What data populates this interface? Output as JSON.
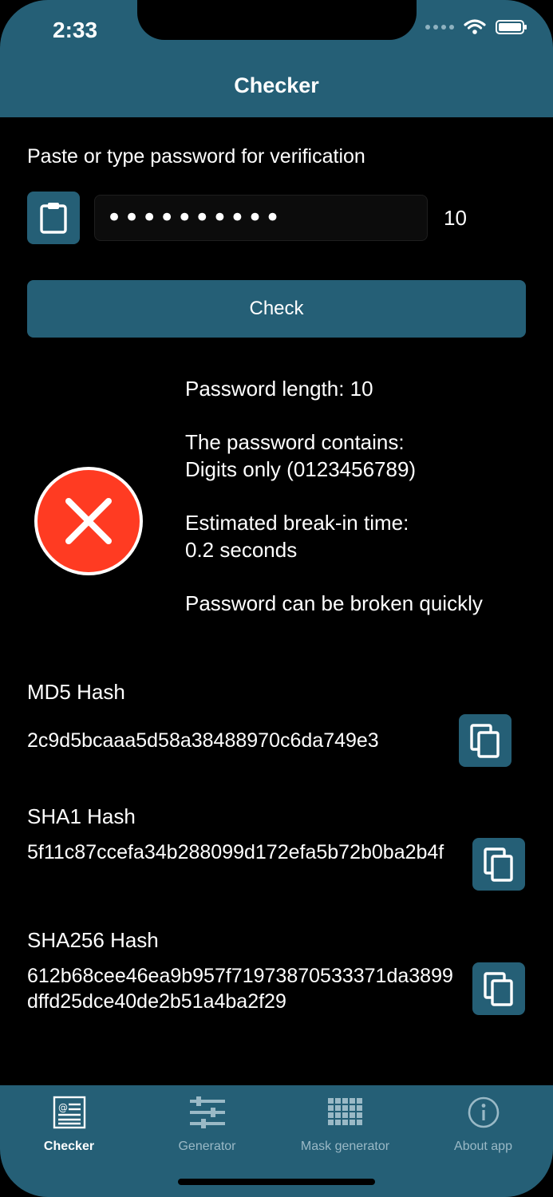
{
  "status": {
    "time": "2:33"
  },
  "nav": {
    "title": "Checker"
  },
  "checker": {
    "prompt": "Paste or type password for verification",
    "password_value": "••••••••••",
    "password_count": "10",
    "check_label": "Check"
  },
  "result": {
    "length": "Password length: 10",
    "contains_title": "The password contains:",
    "contains_value": "Digits only (0123456789)",
    "time_title": "Estimated break-in time:",
    "time_value": "0.2 seconds",
    "verdict": "Password can be broken quickly",
    "status_color": "#ff3b22"
  },
  "hashes": {
    "md5": {
      "label": "MD5 Hash",
      "value": "2c9d5bcaaa5d58a38488970c6da749e3"
    },
    "sha1": {
      "label": "SHA1 Hash",
      "value": "5f11c87ccefa34b288099d172efa5b72b0ba2b4f"
    },
    "sha256": {
      "label": "SHA256 Hash",
      "value": "612b68cee46ea9b957f71973870533371da3899dffd25dce40de2b51a4ba2f29"
    }
  },
  "tabs": [
    {
      "label": "Checker",
      "icon": "checker-icon",
      "active": true
    },
    {
      "label": "Generator",
      "icon": "sliders-icon",
      "active": false
    },
    {
      "label": "Mask generator",
      "icon": "grid-icon",
      "active": false
    },
    {
      "label": "About app",
      "icon": "info-icon",
      "active": false
    }
  ],
  "colors": {
    "accent": "#255f76",
    "background": "#000000",
    "danger": "#ff3b22"
  }
}
